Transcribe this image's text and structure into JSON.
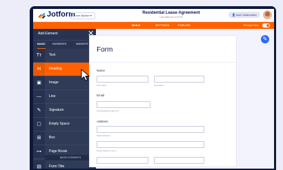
{
  "app": {
    "logo_text": "Jotform",
    "form_builder_label": "Form Builder",
    "form_title": "Residential Lease Agreement",
    "form_subtitle": "Last edited at 10:33 PM",
    "add_collaborator_label": "Add Collaborator"
  },
  "nav": {
    "tabs": [
      "BUILD",
      "SETTINGS",
      "PUBLISH"
    ],
    "preview_label": "Preview Form"
  },
  "sidebar": {
    "title": "Add Element",
    "close_glyph": "✕",
    "tabs": [
      "BASIC",
      "PAYMENTS",
      "WIDGETS"
    ],
    "items": [
      {
        "label": "Text",
        "icon": "Tт"
      },
      {
        "label": "Heading",
        "icon": "H"
      },
      {
        "label": "Image",
        "icon": "▣"
      },
      {
        "label": "Line",
        "icon": "—"
      },
      {
        "label": "Signature",
        "icon": "✎"
      },
      {
        "label": "Empty Space",
        "icon": "▢"
      },
      {
        "label": "Box",
        "icon": "⊞"
      },
      {
        "label": "Page Break",
        "icon": "⊶"
      }
    ],
    "section_label": "BASIC ELEMENTS",
    "after_section_item": {
      "label": "Form Title",
      "icon": "▤"
    }
  },
  "form": {
    "heading": "Form",
    "name_label": "Name",
    "first_name_sub": "First Name",
    "last_name_sub": "Last Name",
    "email_label": "Email",
    "email_sub": "example@example.com",
    "address_label": "Address",
    "street_sub": "Street Address",
    "street2_sub": "Street Address Line 2"
  },
  "colors": {
    "accent": "#ff6100",
    "sidebar": "#2f3b57",
    "brand_navy": "#0a1551",
    "fab": "#2e69ff"
  }
}
